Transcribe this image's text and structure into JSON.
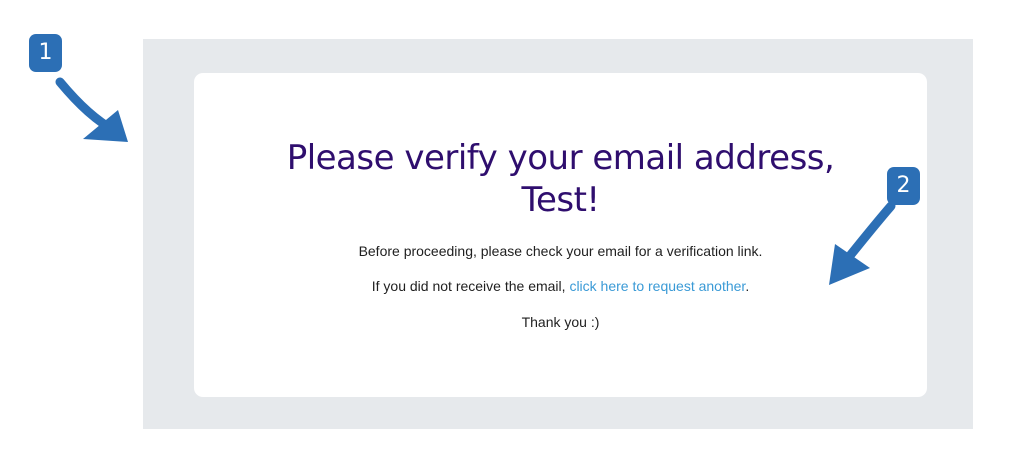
{
  "heading": {
    "line1": "Please verify your email address,",
    "line2": "Test!"
  },
  "body": {
    "instructions": "Before proceeding, please check your email for a verification link.",
    "resend_prefix": "If you did not receive the email, ",
    "resend_link": "click here to request another",
    "resend_suffix": ".",
    "thanks": "Thank you :)"
  },
  "annotations": {
    "badge1": "1",
    "badge2": "2"
  },
  "colors": {
    "heading": "#2f0e6e",
    "link": "#3a9ad6",
    "panel_background": "#e6e9ec",
    "annotation_blue": "#2c6fb5"
  },
  "icons": {
    "arrow1": "arrow-down-right-icon",
    "arrow2": "arrow-down-left-icon"
  }
}
